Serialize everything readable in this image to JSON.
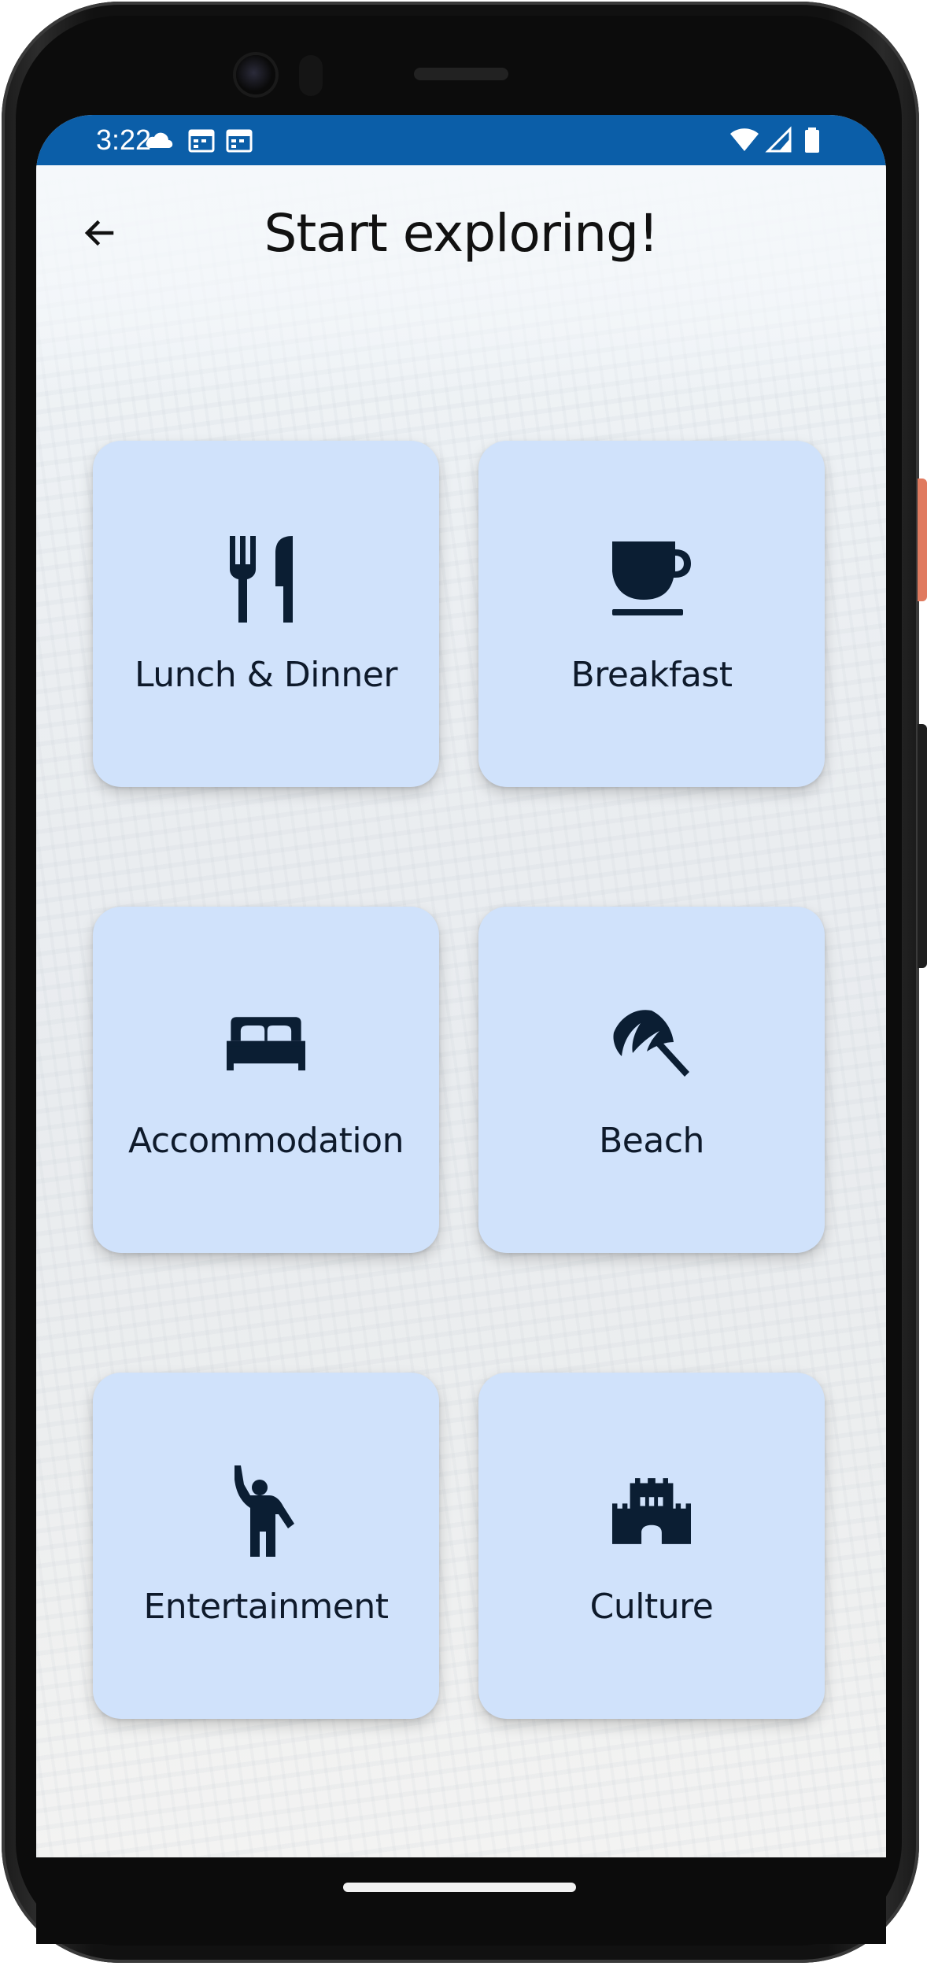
{
  "status_bar": {
    "time": "3:22",
    "icons": [
      "cloud-icon",
      "calendar-icon",
      "calendar-icon",
      "wifi-icon",
      "cellular-signal-icon",
      "battery-icon"
    ],
    "background_color": "#0b5ea8"
  },
  "header": {
    "back_icon": "arrow-left-icon",
    "title": "Start exploring!"
  },
  "categories": [
    {
      "label": "Lunch & Dinner",
      "icon": "fork-knife-icon"
    },
    {
      "label": "Breakfast",
      "icon": "coffee-cup-icon"
    },
    {
      "label": "Accommodation",
      "icon": "bed-icon"
    },
    {
      "label": "Beach",
      "icon": "beach-umbrella-icon"
    },
    {
      "label": "Entertainment",
      "icon": "person-waving-icon"
    },
    {
      "label": "Culture",
      "icon": "castle-icon"
    }
  ],
  "colors": {
    "card_background": "#d0e2fb",
    "icon_color": "#0b1e33",
    "title_color": "#111111"
  }
}
